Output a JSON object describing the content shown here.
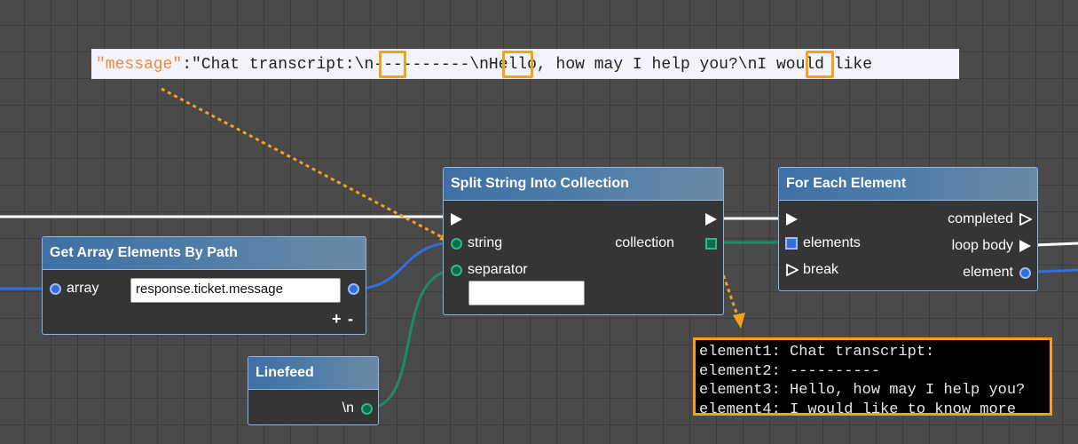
{
  "json_snippet": {
    "key": "\"message\"",
    "colon_text": ":\"Chat transcript:",
    "seg1": "\\n",
    "seg2": "----------",
    "seg3": "\\n",
    "seg4": "Hello, how may I help you?",
    "seg5": "\\n",
    "seg6": "I would like"
  },
  "nodes": {
    "get_array": {
      "title": "Get Array Elements By Path",
      "array_label": "array",
      "path_value": "response.ticket.message",
      "plus": "+",
      "minus": "-"
    },
    "split": {
      "title": "Split String Into Collection",
      "string_label": "string",
      "separator_label": "separator",
      "separator_value": "",
      "collection_label": "collection"
    },
    "foreach": {
      "title": "For Each Element",
      "elements_label": "elements",
      "break_label": "break",
      "completed_label": "completed",
      "loop_body_label": "loop body",
      "element_label": "element"
    },
    "linefeed": {
      "title": "Linefeed",
      "output_label": "\\n"
    }
  },
  "console": {
    "lines": [
      "element1: Chat transcript:",
      "element2: ----------",
      "element3: Hello, how may I help you?",
      "element4: I would like to know more"
    ]
  },
  "colors": {
    "highlight": "#f3a21a",
    "exec_wire": "#ffffff",
    "data_wire_blue": "#2f6fe0",
    "data_wire_green": "#1f8a68"
  }
}
